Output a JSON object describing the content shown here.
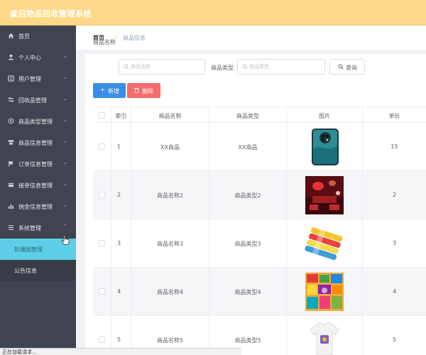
{
  "app": {
    "title": "废旧物品回收管理系统"
  },
  "sidebar": {
    "items": [
      {
        "label": "首页",
        "icon": "home-icon",
        "expandable": false
      },
      {
        "label": "个人中心",
        "icon": "user-icon",
        "expandable": true
      },
      {
        "label": "用户管理",
        "icon": "users-icon",
        "expandable": true
      },
      {
        "label": "回收品管理",
        "icon": "recycle-icon",
        "expandable": true
      },
      {
        "label": "商品类型管理",
        "icon": "category-icon",
        "expandable": true
      },
      {
        "label": "商品信息管理",
        "icon": "goods-icon",
        "expandable": true
      },
      {
        "label": "订单信息管理",
        "icon": "flag-icon",
        "expandable": true
      },
      {
        "label": "接单信息管理",
        "icon": "order-icon",
        "expandable": true
      },
      {
        "label": "佣金信息管理",
        "icon": "chart-icon",
        "expandable": true
      },
      {
        "label": "系统管理",
        "icon": "menu-icon",
        "expandable": true,
        "expanded": true
      }
    ],
    "subitems": [
      {
        "label": "轮播图管理",
        "active": true
      },
      {
        "label": "公告信息",
        "active": false
      }
    ]
  },
  "breadcrumb": {
    "home": "首页",
    "separator": "/",
    "current": "商品信息"
  },
  "filters": {
    "name_label": "商品名称",
    "name_placeholder": "商品名称",
    "type_label": "商品类型",
    "type_placeholder": "商品类型",
    "search_label": "查询"
  },
  "actions": {
    "add_label": "新增",
    "delete_label": "删除"
  },
  "table": {
    "headers": [
      "索引",
      "商品名称",
      "商品类型",
      "图片",
      "单价"
    ],
    "rows": [
      {
        "index": "1",
        "name": "XX商品",
        "type": "XX商品",
        "image": "phone",
        "price": "15"
      },
      {
        "index": "2",
        "name": "商品名称2",
        "type": "商品类型2",
        "image": "red-interior",
        "price": "2"
      },
      {
        "index": "3",
        "name": "商品名称3",
        "type": "商品类型3",
        "image": "snack-tubes",
        "price": "3"
      },
      {
        "index": "4",
        "name": "商品名称4",
        "type": "商品类型4",
        "image": "snack-assortment",
        "price": "4"
      },
      {
        "index": "5",
        "name": "商品名称5",
        "type": "商品类型5",
        "image": "tshirt",
        "price": "5"
      }
    ]
  },
  "status_bar": {
    "text": "正在加载请求..."
  },
  "colors": {
    "topbar": "#fdd989",
    "sidebar": "#3f4450",
    "active_subitem": "#5dcee6",
    "add_button": "#3a8ee6",
    "delete_button": "#f56c6c"
  }
}
